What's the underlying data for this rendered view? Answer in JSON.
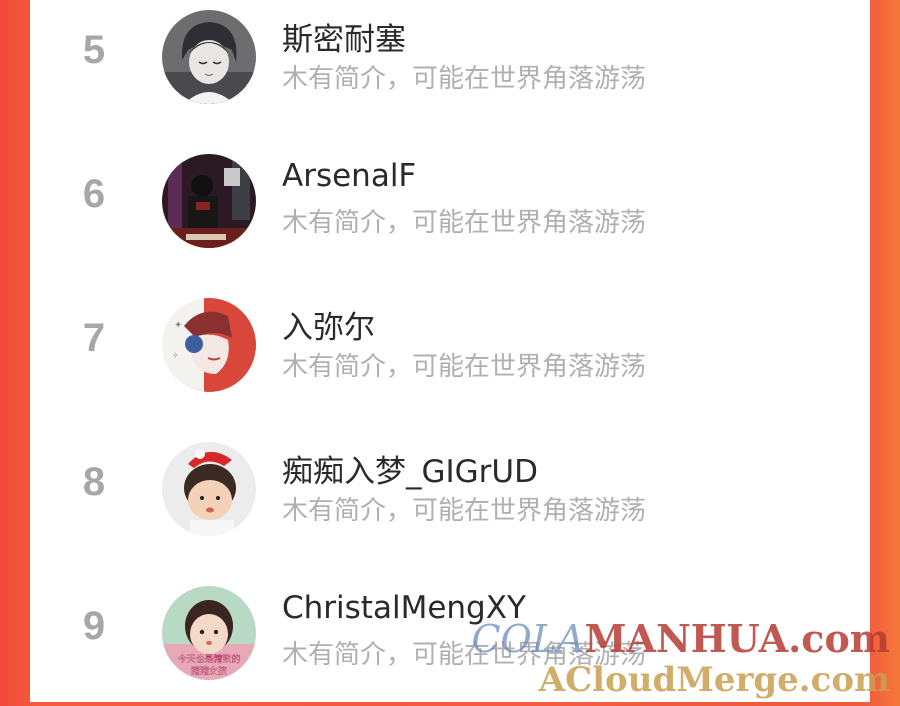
{
  "ranking": {
    "entries": [
      {
        "rank": "5",
        "name": "斯密耐塞",
        "bio": "木有简介，可能在世界角落游荡"
      },
      {
        "rank": "6",
        "name": "ArsenalF",
        "bio": "木有简介，可能在世界角落游荡"
      },
      {
        "rank": "7",
        "name": "入弥尔",
        "bio": "木有简介，可能在世界角落游荡"
      },
      {
        "rank": "8",
        "name": "痴痴入梦_GIGrUD",
        "bio": "木有简介，可能在世界角落游荡"
      },
      {
        "rank": "9",
        "name": "ChristalMengXY",
        "bio": "木有简介，可能在世界角落游荡"
      }
    ]
  },
  "avatar_overlay_text": "今天也是精致的猪猪女孩",
  "watermark": {
    "line1_a": "COLA",
    "line1_b": "MANHUA.com",
    "line2": "ACloudMerge.com"
  },
  "colors": {
    "frame": "#f2493b",
    "rank": "#a7a7a7",
    "name": "#2a2a2a",
    "bio": "#b0b0b0"
  }
}
